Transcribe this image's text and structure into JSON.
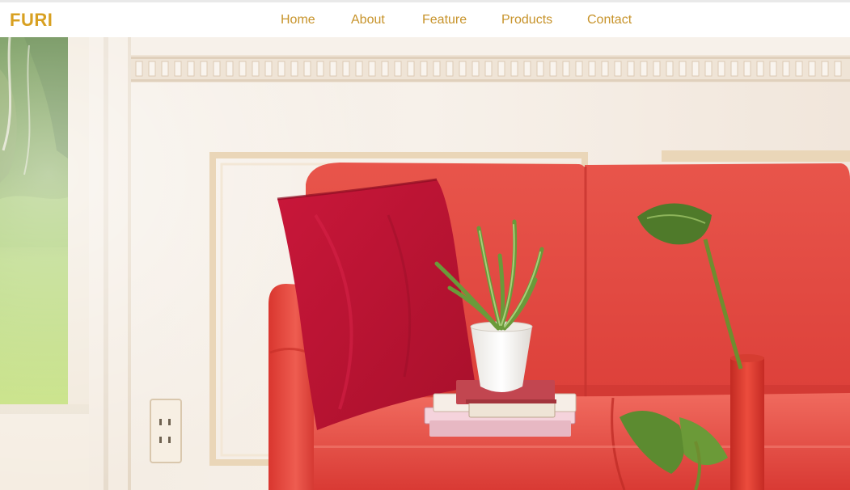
{
  "site": {
    "brand": "FURI",
    "brand_color": "#d8a021"
  },
  "nav": {
    "link_color": "#c7932a",
    "items": [
      {
        "id": "home",
        "label": "Home"
      },
      {
        "id": "about",
        "label": "About"
      },
      {
        "id": "feature",
        "label": "Feature"
      },
      {
        "id": "products",
        "label": "Products"
      },
      {
        "id": "contact",
        "label": "Contact"
      }
    ]
  },
  "hero": {
    "image": "red-sofa-living-room-photo",
    "sofa_color": "#e4453e",
    "pillow_color": "#b51432",
    "wall_color": "#f6eee6",
    "trim_color": "#eed9bd"
  }
}
